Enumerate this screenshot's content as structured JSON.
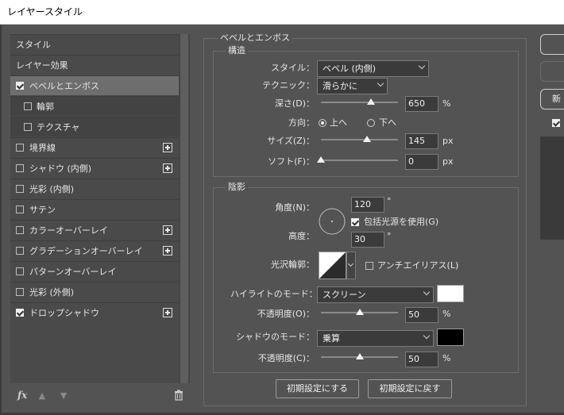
{
  "window": {
    "title": "レイヤースタイル"
  },
  "styles_list": {
    "items": [
      {
        "label": "スタイル",
        "checkbox": false,
        "checked": false,
        "plus": false,
        "sub": false,
        "selected": false
      },
      {
        "label": "レイヤー効果",
        "checkbox": false,
        "checked": false,
        "plus": false,
        "sub": false,
        "selected": false
      },
      {
        "label": "ベベルとエンボス",
        "checkbox": true,
        "checked": true,
        "plus": false,
        "sub": false,
        "selected": true
      },
      {
        "label": "輪郭",
        "checkbox": true,
        "checked": false,
        "plus": false,
        "sub": true,
        "selected": false
      },
      {
        "label": "テクスチャ",
        "checkbox": true,
        "checked": false,
        "plus": false,
        "sub": true,
        "selected": false
      },
      {
        "label": "境界線",
        "checkbox": true,
        "checked": false,
        "plus": true,
        "sub": false,
        "selected": false
      },
      {
        "label": "シャドウ (内側)",
        "checkbox": true,
        "checked": false,
        "plus": true,
        "sub": false,
        "selected": false
      },
      {
        "label": "光彩 (内側)",
        "checkbox": true,
        "checked": false,
        "plus": false,
        "sub": false,
        "selected": false
      },
      {
        "label": "サテン",
        "checkbox": true,
        "checked": false,
        "plus": false,
        "sub": false,
        "selected": false
      },
      {
        "label": "カラーオーバーレイ",
        "checkbox": true,
        "checked": false,
        "plus": true,
        "sub": false,
        "selected": false
      },
      {
        "label": "グラデーションオーバーレイ",
        "checkbox": true,
        "checked": false,
        "plus": true,
        "sub": false,
        "selected": false
      },
      {
        "label": "パターンオーバーレイ",
        "checkbox": true,
        "checked": false,
        "plus": false,
        "sub": false,
        "selected": false
      },
      {
        "label": "光彩 (外側)",
        "checkbox": true,
        "checked": false,
        "plus": false,
        "sub": false,
        "selected": false
      },
      {
        "label": "ドロップシャドウ",
        "checkbox": true,
        "checked": true,
        "plus": true,
        "sub": false,
        "selected": false
      }
    ],
    "fx_label": "fx"
  },
  "bevel": {
    "group_title": "ベベルとエンボス",
    "structure_title": "構造",
    "style_label": "スタイル：",
    "style_value": "ベベル (内側)",
    "technique_label": "テクニック：",
    "technique_value": "滑らかに",
    "depth_label": "深さ(D)：",
    "depth_value": "650",
    "depth_level": 0.65,
    "depth_unit": "%",
    "direction_label": "方向：",
    "direction_up": "上へ",
    "direction_down": "下へ",
    "direction_selected": "up",
    "size_label": "サイズ(Z)：",
    "size_value": "145",
    "size_level": 0.6,
    "size_unit": "px",
    "soften_label": "ソフト(F)：",
    "soften_value": "0",
    "soften_level": 0,
    "soften_unit": "px"
  },
  "shading": {
    "title": "陰影",
    "angle_label": "角度(N)：",
    "angle_value": "120",
    "angle_unit": "°",
    "global_light_label": "包括光源を使用(G)",
    "global_light_checked": true,
    "altitude_label": "高度：",
    "altitude_value": "30",
    "altitude_unit": "°",
    "gloss_contour_label": "光沢輪郭：",
    "antialias_label": "アンチエイリアス(L)",
    "antialias_checked": false,
    "highlight_mode_label": "ハイライトのモード：",
    "highlight_mode_value": "スクリーン",
    "highlight_color": "#ffffff",
    "highlight_opacity_label": "不透明度(O)：",
    "highlight_opacity_value": "50",
    "highlight_opacity_level": 0.5,
    "highlight_opacity_unit": "%",
    "shadow_mode_label": "シャドウのモード：",
    "shadow_mode_value": "乗算",
    "shadow_color": "#000000",
    "shadow_opacity_label": "不透明度(C)：",
    "shadow_opacity_value": "50",
    "shadow_opacity_level": 0.5,
    "shadow_opacity_unit": "%"
  },
  "buttons": {
    "make_default": "初期設定にする",
    "reset_default": "初期設定に戻す",
    "new_partial": "新"
  }
}
